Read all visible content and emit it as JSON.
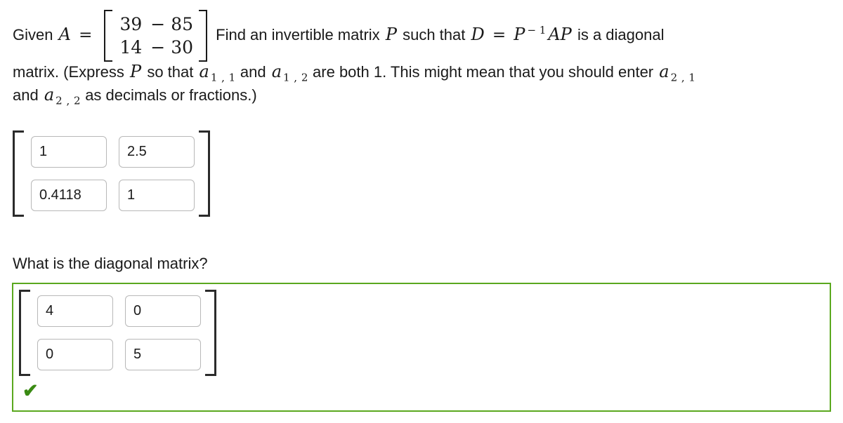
{
  "problem": {
    "intro": "Given",
    "matrix_symbol": "A",
    "equals": "=",
    "matrix_A": {
      "rows": [
        [
          "39",
          "− 85"
        ],
        [
          "14",
          "− 30"
        ]
      ]
    },
    "sentence_1a": "Find an invertible matrix",
    "p_symbol": "P",
    "sentence_1b": "such that",
    "d_symbol": "D",
    "equals2": "=",
    "p_symbol_2": "P",
    "superscript_inverse": "− 1",
    "ap_symbol": "AP",
    "sentence_1c": "is a diagonal",
    "line2_a": "matrix.  (Express",
    "p_symbol_3": "P",
    "line2_b": "so that",
    "a11_base": "a",
    "a11_sub": "1 , 1",
    "line2_c": "and",
    "a12_base": "a",
    "a12_sub": "1 , 2",
    "line2_d": "are both 1.  This might mean that you should enter",
    "a21_base": "a",
    "a21_sub": "2 , 1",
    "line3_a": "and",
    "a22_base": "a",
    "a22_sub": "2 , 2",
    "line3_b": "as decimals or fractions.)"
  },
  "answer_p": {
    "label": "matrix-P-answer",
    "values": [
      [
        "1",
        "2.5"
      ],
      [
        "0.4118",
        "1"
      ]
    ],
    "placeholder": ""
  },
  "question_2": {
    "label": "What is the diagonal matrix?"
  },
  "answer_d": {
    "label": "matrix-D-answer",
    "values": [
      [
        "4",
        "0"
      ],
      [
        "0",
        "5"
      ]
    ],
    "placeholder": "",
    "status": "correct",
    "status_icon": "check-icon",
    "status_glyph": "✔",
    "border_color": "#5aa81e",
    "check_color": "#3a8a13"
  },
  "colors": {
    "background": "#ffffff",
    "text": "#1a1a1a",
    "input_border": "#b8b8b8",
    "bracket": "#2b2b2b",
    "correct_green": "#5aa81e"
  }
}
